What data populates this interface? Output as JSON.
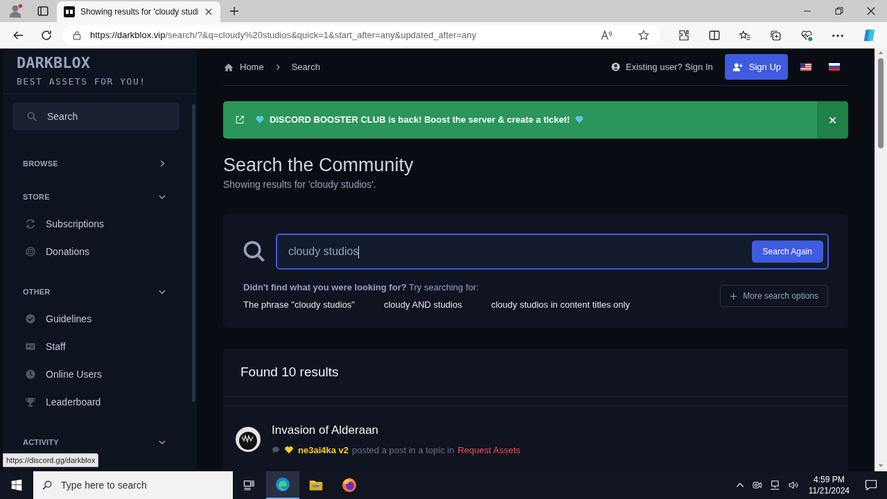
{
  "browser": {
    "tab_title": "Showing results for 'cloudy studi",
    "url_host": "https://darkblox.vip",
    "url_path": "/search/?&q=cloudy%20studios&quick=1&start_after=any&updated_after=any"
  },
  "sidebar": {
    "logo": "DARKBLOX",
    "tagline": "BEST ASSETS FOR YOU!",
    "search_placeholder": "Search",
    "sections": [
      {
        "title": "BROWSE",
        "expanded": false
      },
      {
        "title": "STORE",
        "expanded": true,
        "items": [
          "Subscriptions",
          "Donations"
        ]
      },
      {
        "title": "OTHER",
        "expanded": true,
        "items": [
          "Guidelines",
          "Staff",
          "Online Users",
          "Leaderboard"
        ]
      },
      {
        "title": "ACTIVITY",
        "expanded": true
      }
    ]
  },
  "breadcrumb": [
    "Home",
    "Search"
  ],
  "account": {
    "sign_in": "Existing user? Sign In",
    "sign_up": "Sign Up"
  },
  "announcement": "DISCORD BOOSTER CLUB is back! Boost the server & create a ticket!",
  "heading": {
    "title": "Search the Community",
    "subtitle": "Showing results for 'cloudy studios'."
  },
  "search": {
    "value": "cloudy studios",
    "button": "Search Again",
    "hint": "**Didn't find what you were looking for?** Try searching for:",
    "suggestions": [
      "The phrase \"cloudy studios\"",
      "cloudy AND studios",
      "cloudy studios in content titles only"
    ],
    "more_options": "More search options"
  },
  "results": {
    "title": "Found 10 results",
    "items": [
      {
        "title": "Invasion of Alderaan",
        "user": "ne3ai4ka v2",
        "action": "posted a post in a topic in",
        "forum": "Request Assets"
      }
    ]
  },
  "status_url": "https://discord.gg/darkblox",
  "taskbar": {
    "search_placeholder": "Type here to search",
    "time": "4:59 PM",
    "date": "11/21/2024"
  }
}
